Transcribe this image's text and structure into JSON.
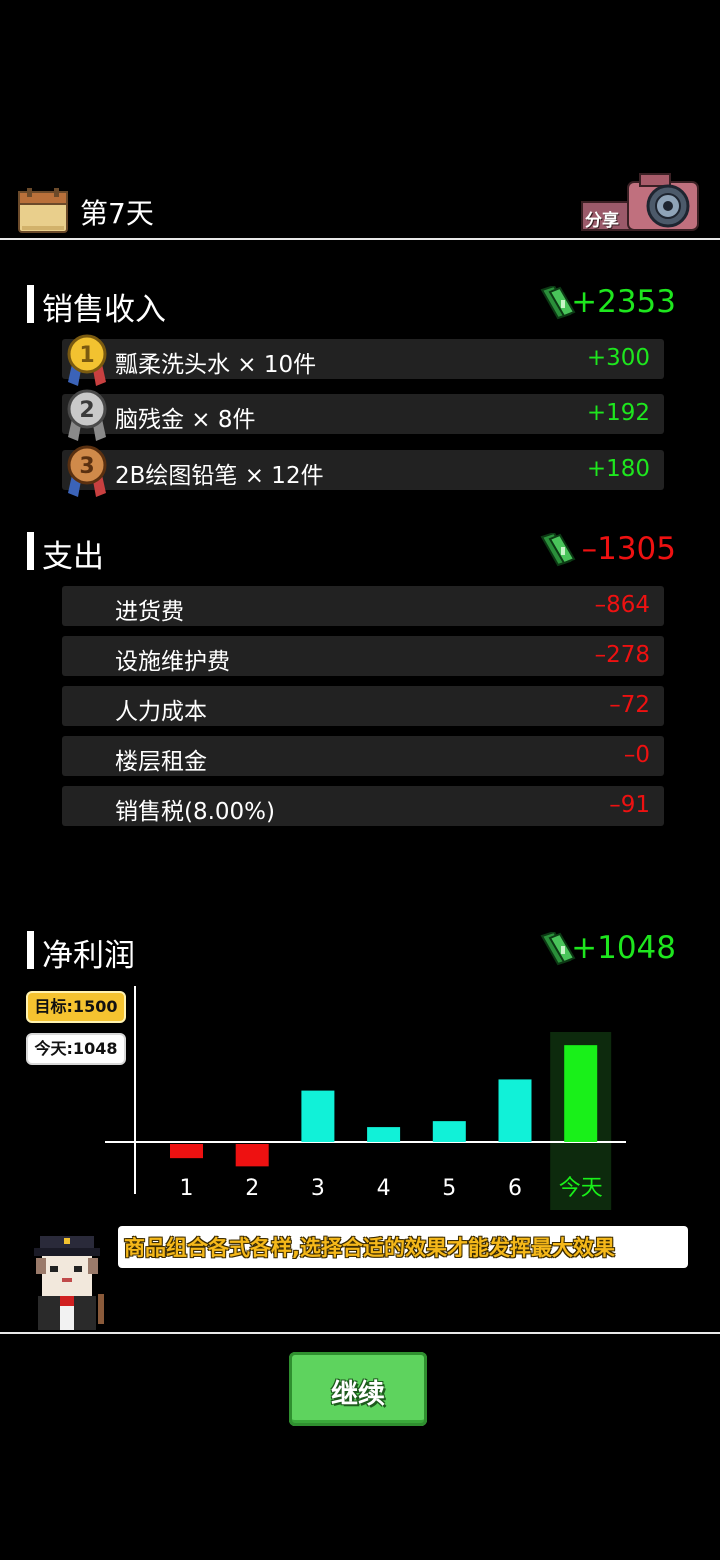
{
  "header": {
    "day_label": "第7天",
    "share_label": "分享"
  },
  "sales": {
    "title": "销售收入",
    "total": "+2353",
    "items": [
      {
        "rank": "1",
        "label": "瓢柔洗头水 × 10件",
        "value": "+300"
      },
      {
        "rank": "2",
        "label": "脑残金 × 8件",
        "value": "+192"
      },
      {
        "rank": "3",
        "label": "2B绘图铅笔 × 12件",
        "value": "+180"
      }
    ]
  },
  "expenses": {
    "title": "支出",
    "total": "–1305",
    "items": [
      {
        "label": "进货费",
        "value": "–864"
      },
      {
        "label": "设施维护费",
        "value": "–278"
      },
      {
        "label": "人力成本",
        "value": "–72"
      },
      {
        "label": "楼层租金",
        "value": "–0"
      },
      {
        "label": "销售税(8.00%)",
        "value": "–91"
      }
    ]
  },
  "profit": {
    "title": "净利润",
    "total": "+1048",
    "target_badge": "目标:1500",
    "today_badge": "今天:1048"
  },
  "chart_data": {
    "type": "bar",
    "categories": [
      "1",
      "2",
      "3",
      "4",
      "5",
      "6",
      "今天"
    ],
    "values": [
      -190,
      -300,
      690,
      200,
      280,
      840,
      1300
    ],
    "highlight_index": 6,
    "colors": {
      "positive": "#11f1d8",
      "negative": "#ee1111",
      "today": "#19f019",
      "today_bg": "#0d2a0d"
    }
  },
  "tip": {
    "text": "商品组合各式各样,选择合适的效果才能发挥最大效果"
  },
  "continue_button": {
    "label": "继续"
  },
  "colors": {
    "positive": "#1ee61e",
    "negative": "#ee1111",
    "background": "#000000",
    "row_bg": "#222222"
  }
}
